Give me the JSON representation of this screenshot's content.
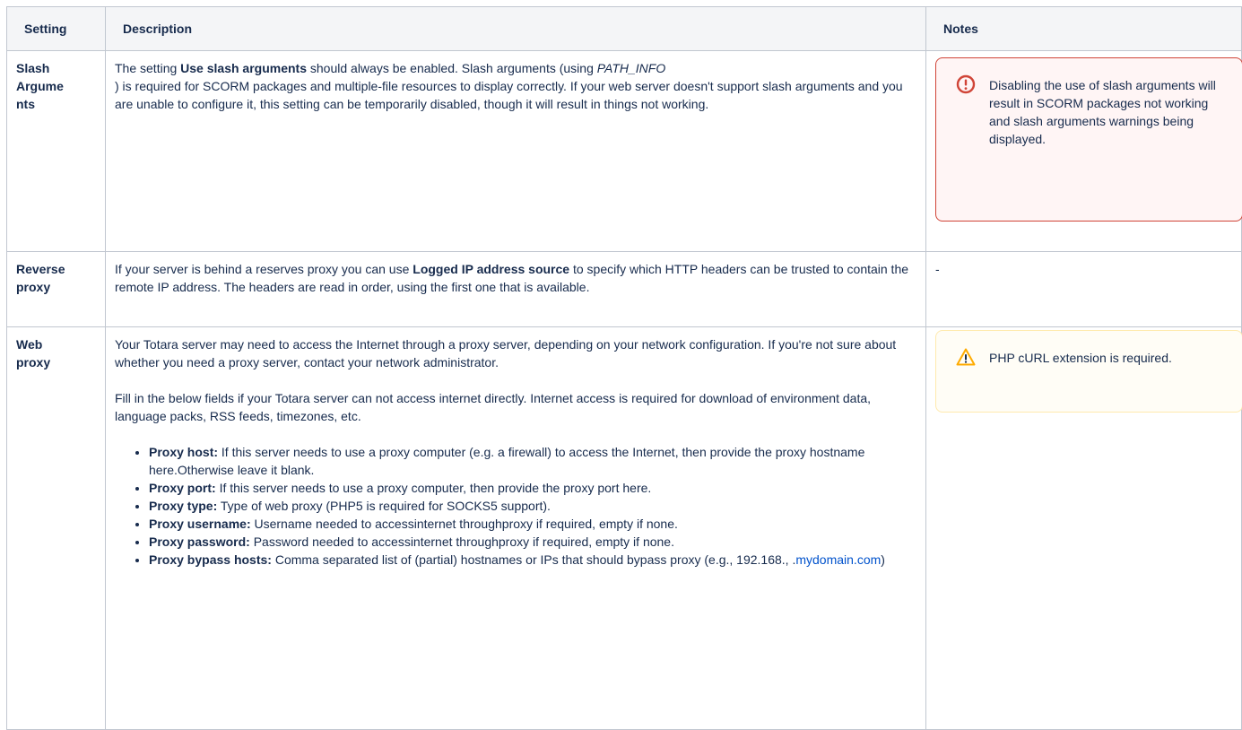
{
  "table": {
    "headers": [
      "Setting",
      "Description",
      "Notes"
    ],
    "rows": [
      {
        "setting_lines": [
          "Slash",
          "Argume",
          "nts"
        ],
        "desc": {
          "t1": "The setting ",
          "b1": "Use slash arguments",
          "t2": " should always be enabled.  Slash arguments (using ",
          "i1": "PATH_INFO",
          "t3": ") is required for SCORM packages and multiple-file resources to display correctly. If your web server doesn't support slash arguments and you are unable to configure it, this setting can be temporarily disabled, though it will result in things not working."
        },
        "note": {
          "type": "error",
          "icon": "error-circle-icon",
          "text": "Disabling the use of slash arguments will result in SCORM packages not working and slash arguments warnings being displayed.",
          "border_color": "#d04437",
          "background": "#fff5f5"
        }
      },
      {
        "setting_lines": [
          "Reverse",
          "proxy"
        ],
        "desc": {
          "t1": "If your server is behind a reserves proxy you can use ",
          "b1": "Logged IP address source",
          "t2": " to specify which HTTP headers can be trusted to contain the remote IP address. The headers are read in order, using the first one that is available."
        },
        "note": {
          "text": "-"
        }
      },
      {
        "setting_lines": [
          "Web",
          "proxy"
        ],
        "desc": {
          "p1": "Your Totara server may need to access the Internet through a proxy server, depending on your network configuration. If you're not sure about whether you need a proxy server, contact your network administrator.",
          "p2": "Fill in the below fields if your Totara server can not access internet directly. Internet access is required for download of environment data, language packs, RSS feeds, timezones, etc.",
          "bullets": [
            {
              "label": "Proxy host:",
              "text": " If this server needs to use a proxy computer (e.g. a firewall) to access the Internet, then provide the proxy hostname here.Otherwise leave it blank."
            },
            {
              "label": "Proxy port:",
              "text": " If this server needs to use a proxy computer, then provide the proxy port here."
            },
            {
              "label": "Proxy type:",
              "text": " Type of web proxy (PHP5 is required for SOCKS5 support)."
            },
            {
              "label": "Proxy username:",
              "text": " Username needed to accessinternet throughproxy if required, empty if none."
            },
            {
              "label": "Proxy password:",
              "text": " Password needed to accessinternet throughproxy if required, empty if none."
            },
            {
              "label": "Proxy bypass hosts:",
              "text": " Comma separated list of (partial) hostnames or IPs that should bypass proxy (e.g., 192.168., .",
              "link": "mydomain.com",
              "after": ")"
            }
          ]
        },
        "note": {
          "type": "warning",
          "icon": "warning-triangle-icon",
          "text": "PHP cURL extension is required.",
          "border_color": "#ffeaae",
          "background": "#fffdf6"
        }
      }
    ]
  },
  "colors": {
    "border": "#c1c7d0",
    "header_bg": "#f4f5f7",
    "text": "#172b4d",
    "link": "#0052cc",
    "error_icon": "#d04437",
    "warning_icon": "#ffab00"
  }
}
